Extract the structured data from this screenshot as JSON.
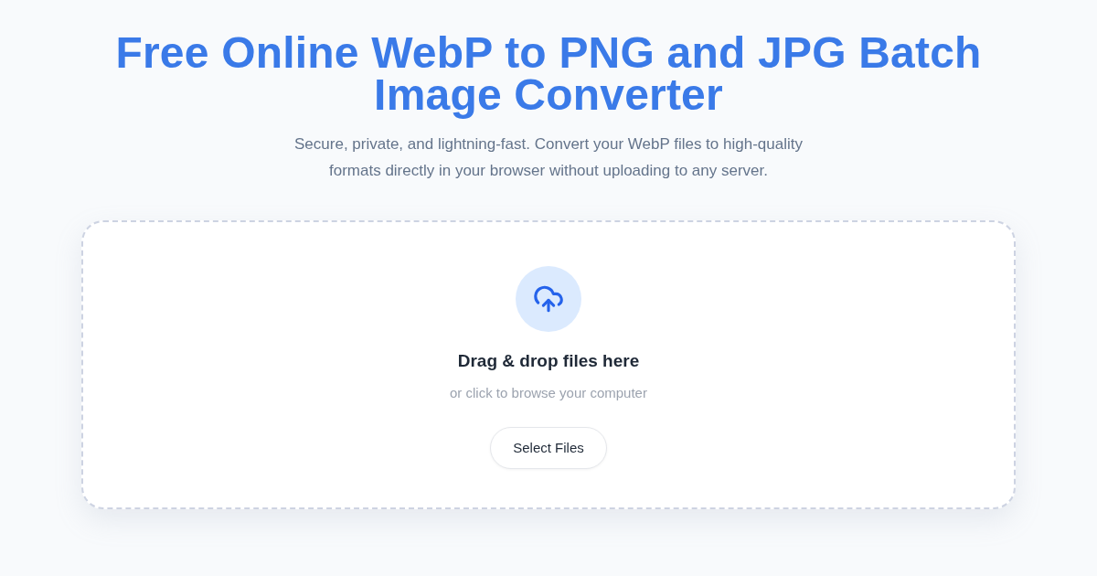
{
  "header": {
    "title": "Free Online WebP to PNG and JPG Batch Image Converter",
    "subtitle": "Secure, private, and lightning-fast. Convert your WebP files to high-quality formats directly in your browser without uploading to any server."
  },
  "dropzone": {
    "heading": "Drag & drop files here",
    "hint": "or click to browse your computer",
    "button": "Select Files"
  }
}
